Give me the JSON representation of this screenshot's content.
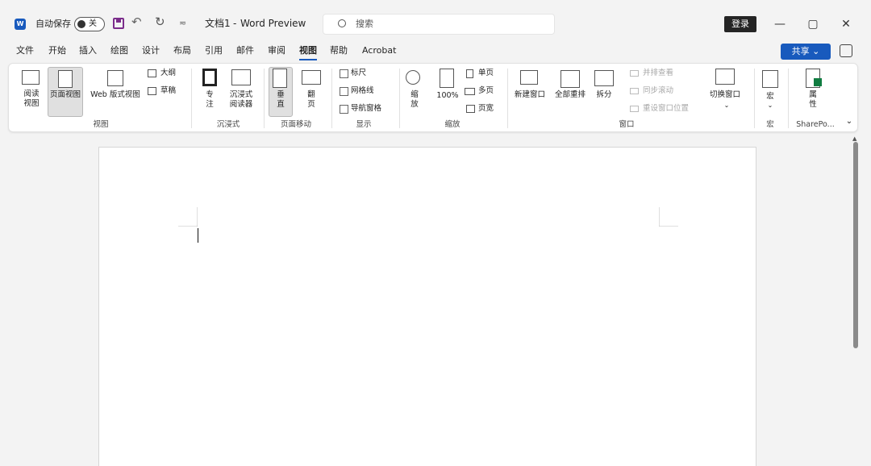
{
  "titlebar": {
    "autosave_label": "自动保存",
    "autosave_state": "关",
    "doc_title": "文档1",
    "separator": "-",
    "app_name": "Word Preview",
    "search_placeholder": "搜索",
    "login_label": "登录",
    "undo_symbol": "↶",
    "redo_symbol": "↻",
    "qat_more_symbol": "≂",
    "minimize_symbol": "—",
    "restore_symbol": "▢",
    "close_symbol": "✕"
  },
  "tabs": [
    "文件",
    "开始",
    "插入",
    "绘图",
    "设计",
    "布局",
    "引用",
    "邮件",
    "审阅",
    "视图",
    "帮助",
    "Acrobat"
  ],
  "active_tab": "视图",
  "share_label": "共享",
  "ribbon": {
    "views": {
      "read_mode": "阅读视图",
      "read_mode_line1": "阅读",
      "read_mode_line2": "视图",
      "print_layout": "页面视图",
      "web_layout": "Web 版式视图",
      "outline": "大纲",
      "draft": "草稿",
      "group": "视图"
    },
    "immersive": {
      "focus_line1": "专",
      "focus_line2": "注",
      "reader_line1": "沉浸式",
      "reader_line2": "阅读器",
      "group": "沉浸式"
    },
    "page_movement": {
      "vertical_line1": "垂",
      "vertical_line2": "直",
      "side_line1": "翻",
      "side_line2": "页",
      "group": "页面移动"
    },
    "show": {
      "ruler": "标尺",
      "gridlines": "网格线",
      "nav_pane": "导航窗格",
      "group": "显示"
    },
    "zoom": {
      "zoom_line1": "缩",
      "zoom_line2": "放",
      "hundred": "100%",
      "one_page": "单页",
      "multi_page": "多页",
      "page_width": "页宽",
      "group": "缩放"
    },
    "window": {
      "new_window": "新建窗口",
      "arrange_all": "全部重排",
      "split": "拆分",
      "side_by_side": "并排查看",
      "sync_scroll": "同步滚动",
      "reset_position": "重设窗口位置",
      "switch_windows": "切换窗口",
      "group": "窗口"
    },
    "macros": {
      "label": "宏",
      "group": "宏"
    },
    "sharepoint": {
      "properties_line1": "属",
      "properties_line2": "性",
      "group": "SharePo..."
    }
  },
  "colors": {
    "accent": "#185abd",
    "save_icon": "#7b2d8b",
    "sharepoint_green": "#107c41",
    "ribbon_bg": "#ffffff",
    "app_bg": "#f3f3f3"
  }
}
